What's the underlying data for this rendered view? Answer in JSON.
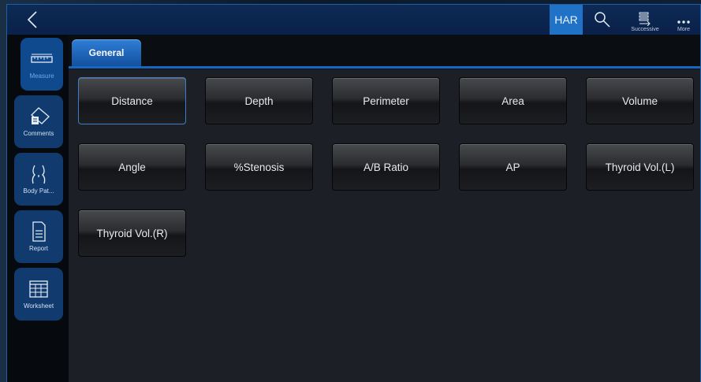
{
  "topbar": {
    "har_label": "HAR",
    "successive_label": "Successive",
    "more_label": "More",
    "icons": {
      "back": "chevron-left-icon",
      "search": "search-icon",
      "successive": "list-arrow-icon",
      "more": "ellipsis-icon"
    }
  },
  "sidebar": {
    "items": [
      {
        "label": "Measure",
        "icon": "ruler-icon",
        "active": true
      },
      {
        "label": "Comments",
        "icon": "comment-tag-icon",
        "active": false
      },
      {
        "label": "Body Pat...",
        "icon": "body-pattern-icon",
        "active": false
      },
      {
        "label": "Report",
        "icon": "document-icon",
        "active": false
      },
      {
        "label": "Worksheet",
        "icon": "worksheet-icon",
        "active": false
      }
    ]
  },
  "tabs": [
    {
      "label": "General",
      "active": true
    }
  ],
  "measurements": [
    {
      "label": "Distance",
      "selected": true
    },
    {
      "label": "Depth"
    },
    {
      "label": "Perimeter"
    },
    {
      "label": "Area"
    },
    {
      "label": "Volume"
    },
    {
      "label": "Angle"
    },
    {
      "label": "%Stenosis"
    },
    {
      "label": "A/B Ratio"
    },
    {
      "label": "AP"
    },
    {
      "label": "Thyroid Vol.(L)"
    },
    {
      "label": "Thyroid Vol.(R)"
    }
  ],
  "colors": {
    "accent": "#1f72c6",
    "topbar": "#0d2a56",
    "sidebar_item": "#113a6e",
    "content_bg": "#1c1f25"
  }
}
